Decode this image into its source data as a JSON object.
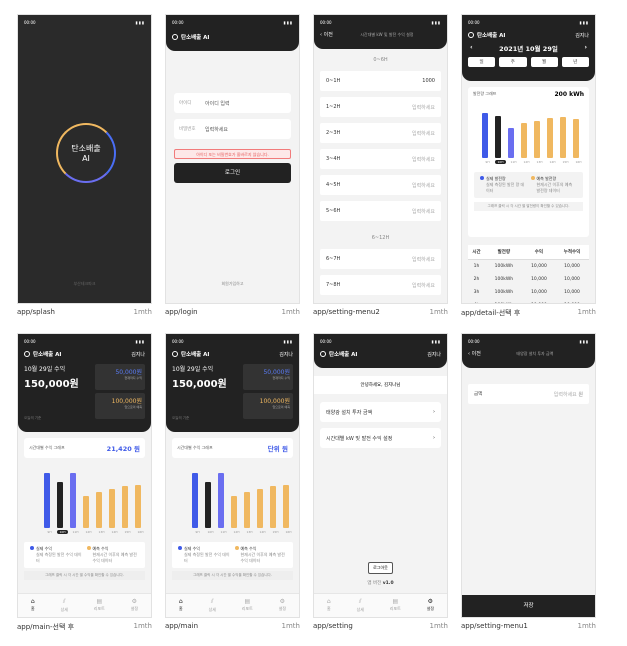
{
  "screens": {
    "splash": {
      "caption": "app/splash",
      "time": "1mth",
      "clock": "00:00",
      "title": "탄소배출",
      "subtitle": "AI",
      "footer": "부산테크파크"
    },
    "login": {
      "caption": "app/login",
      "time": "1mth",
      "clock": "00:00",
      "app": "탄소배출 AI",
      "id_label": "아이디",
      "id_value": "아이디 입력",
      "pw_label": "비밀번호",
      "pw_value": "입력하세요",
      "error": "아이디 또는 비밀번호가 올바르지 않습니다.",
      "login": "로그인",
      "footer": "회원가입하고"
    },
    "setting2": {
      "caption": "app/setting-menu2",
      "time": "1mth",
      "clock": "00:00",
      "back": "이전",
      "title": "시간대별 kW 및 발전 수익 설정",
      "sec1": "0~6H",
      "rows": [
        {
          "k": "0~1H",
          "v": "1000"
        },
        {
          "k": "1~2H",
          "v": "입력하세요"
        },
        {
          "k": "2~3H",
          "v": "입력하세요"
        },
        {
          "k": "3~4H",
          "v": "입력하세요"
        },
        {
          "k": "4~5H",
          "v": "입력하세요"
        },
        {
          "k": "5~6H",
          "v": "입력하세요"
        }
      ],
      "sec2": "6~12H",
      "rows2": [
        {
          "k": "6~7H",
          "v": "입력하세요"
        },
        {
          "k": "7~8H",
          "v": "입력하세요"
        }
      ]
    },
    "detail": {
      "caption": "app/detail-선택 후",
      "time": "1mth",
      "clock": "00:00",
      "app": "탄소배출 AI",
      "user": "김지나",
      "date": "2021년 10월 29일",
      "tabs": [
        "일",
        "주",
        "월",
        "년"
      ],
      "chart_title": "발전량 그래프",
      "total": "200 kWh",
      "legend_a": "실제 발전량",
      "legend_a_sub": "실제 측정된 발전 량 데이터",
      "legend_b": "예측 발전량",
      "legend_b_sub": "현재시간 이후의 예측 발전량 데이터",
      "note": "그래프 클릭 시 각 시간 별 발전량이 확인할 수 있습니다.",
      "table_head": [
        "시간",
        "발전량",
        "수익",
        "누적수익"
      ],
      "table": [
        [
          "1h",
          "100kWh",
          "10,000",
          "10,000"
        ],
        [
          "2h",
          "100kWh",
          "10,000",
          "10,000"
        ],
        [
          "3h",
          "100kWh",
          "10,000",
          "10,000"
        ],
        [
          "4h",
          "100kWh",
          "10,000",
          "10,000"
        ]
      ]
    },
    "main_sel": {
      "caption": "app/main-선택 후",
      "time": "1mth",
      "clock": "00:00",
      "app": "탄소배출 AI",
      "user": "김지나",
      "date": "10월 29일 수익",
      "amount": "150,000원",
      "box1": "50,000원",
      "box1_sub": "현재까지 수익",
      "box2": "100,000원",
      "box2_sub": "앞으로의 예측",
      "small": "오늘의 기준",
      "chart_title": "시간대별 수익 그래프",
      "chart_val": "21,420 원",
      "legend_a": "실제 수익",
      "legend_a_sub": "실제 측정된 발전 수익 데이터",
      "legend_b": "예측 수익",
      "legend_b_sub": "현재시간 이후의 예측 발전 수익 데이터",
      "note": "그래프 클릭 시 각 시간 별 수익을 확인할 수 있습니다.",
      "tabs": [
        "홈",
        "상세",
        "리포트",
        "설정"
      ]
    },
    "main": {
      "caption": "app/main",
      "time": "1mth",
      "clock": "00:00",
      "app": "탄소배출 AI",
      "user": "김지나",
      "date": "10월 29일 수익",
      "amount": "150,000원",
      "box1": "50,000원",
      "box1_sub": "현재까지 수익",
      "box2": "100,000원",
      "box2_sub": "앞으로의 예측",
      "small": "오늘의 기준",
      "chart_title": "시간대별 수익 그래프",
      "chart_val": "단위 원",
      "legend_a": "실제 수익",
      "legend_a_sub": "실제 측정된 발전 수익 데이터",
      "legend_b": "예측 수익",
      "legend_b_sub": "현재시간 이후의 예측 발전 수익 데이터",
      "note": "그래프 클릭 시 각 시간 별 수익을 확인할 수 있습니다.",
      "tabs": [
        "홈",
        "상세",
        "리포트",
        "설정"
      ]
    },
    "setting": {
      "caption": "app/setting",
      "time": "1mth",
      "clock": "00:00",
      "app": "탄소배출 AI",
      "user": "김지나",
      "greet": "안녕하세요, 김지나님",
      "item1": "태양광 설치 투자 금액",
      "item2": "시간대별 kW 및 발전 수익 설정",
      "logout": "로그아웃",
      "version_label": "앱 버전",
      "version": "v1.0",
      "tabs": [
        "홈",
        "상세",
        "리포트",
        "설정"
      ]
    },
    "setting1": {
      "caption": "app/setting-menu1",
      "time": "1mth",
      "clock": "00:00",
      "back": "이전",
      "title": "태양광 설치 투자 금액",
      "field": "금액",
      "placeholder": "입력하세요",
      "unit": "원",
      "save": "저장"
    }
  }
}
